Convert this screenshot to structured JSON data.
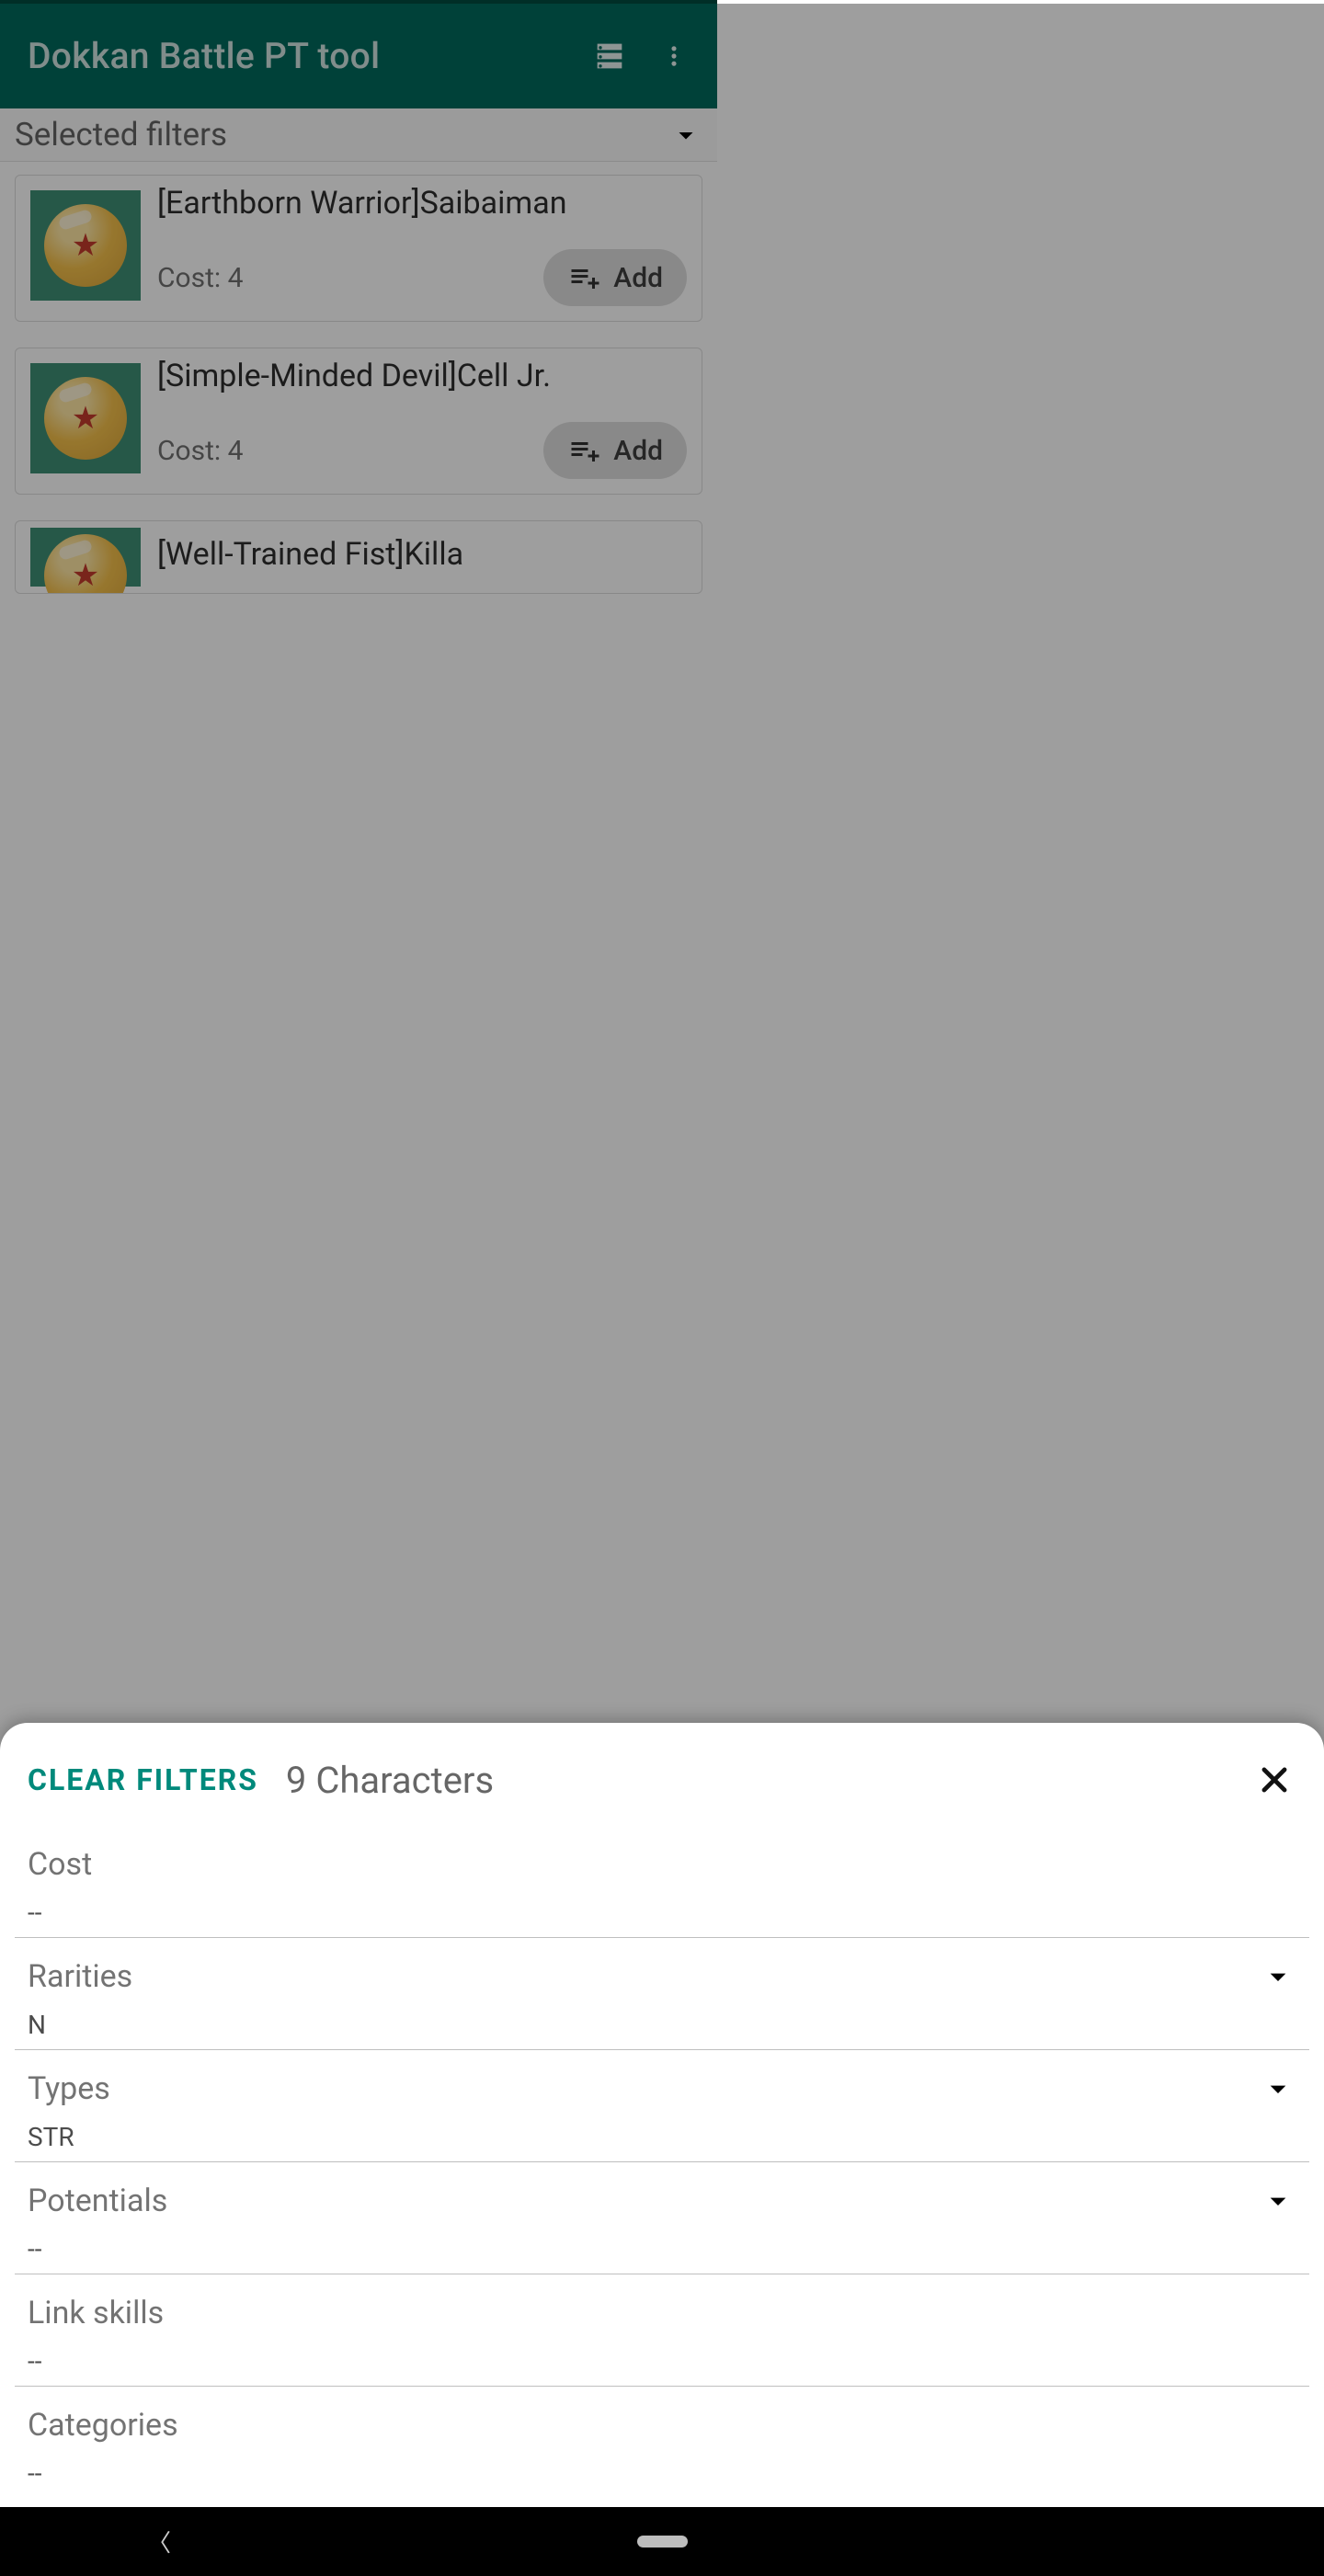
{
  "appbar": {
    "title": "Dokkan Battle PT tool"
  },
  "filters_bar": {
    "label": "Selected filters"
  },
  "cards": [
    {
      "title": "[Earthborn Warrior]Saibaiman",
      "cost": "Cost: 4",
      "add": "Add"
    },
    {
      "title": "[Simple-Minded Devil]Cell Jr.",
      "cost": "Cost: 4",
      "add": "Add"
    },
    {
      "title": "[Well-Trained Fist]Killa",
      "cost": "",
      "add": ""
    }
  ],
  "sheet": {
    "clear": "Clear filters",
    "title": "9 Characters",
    "fields": [
      {
        "label": "Cost",
        "value": "--",
        "expand": false
      },
      {
        "label": "Rarities",
        "value": "N",
        "expand": true
      },
      {
        "label": "Types",
        "value": "STR",
        "expand": true
      },
      {
        "label": "Potentials",
        "value": "--",
        "expand": true
      },
      {
        "label": "Link skills",
        "value": "--",
        "expand": false
      },
      {
        "label": "Categories",
        "value": "--",
        "expand": false
      }
    ]
  }
}
